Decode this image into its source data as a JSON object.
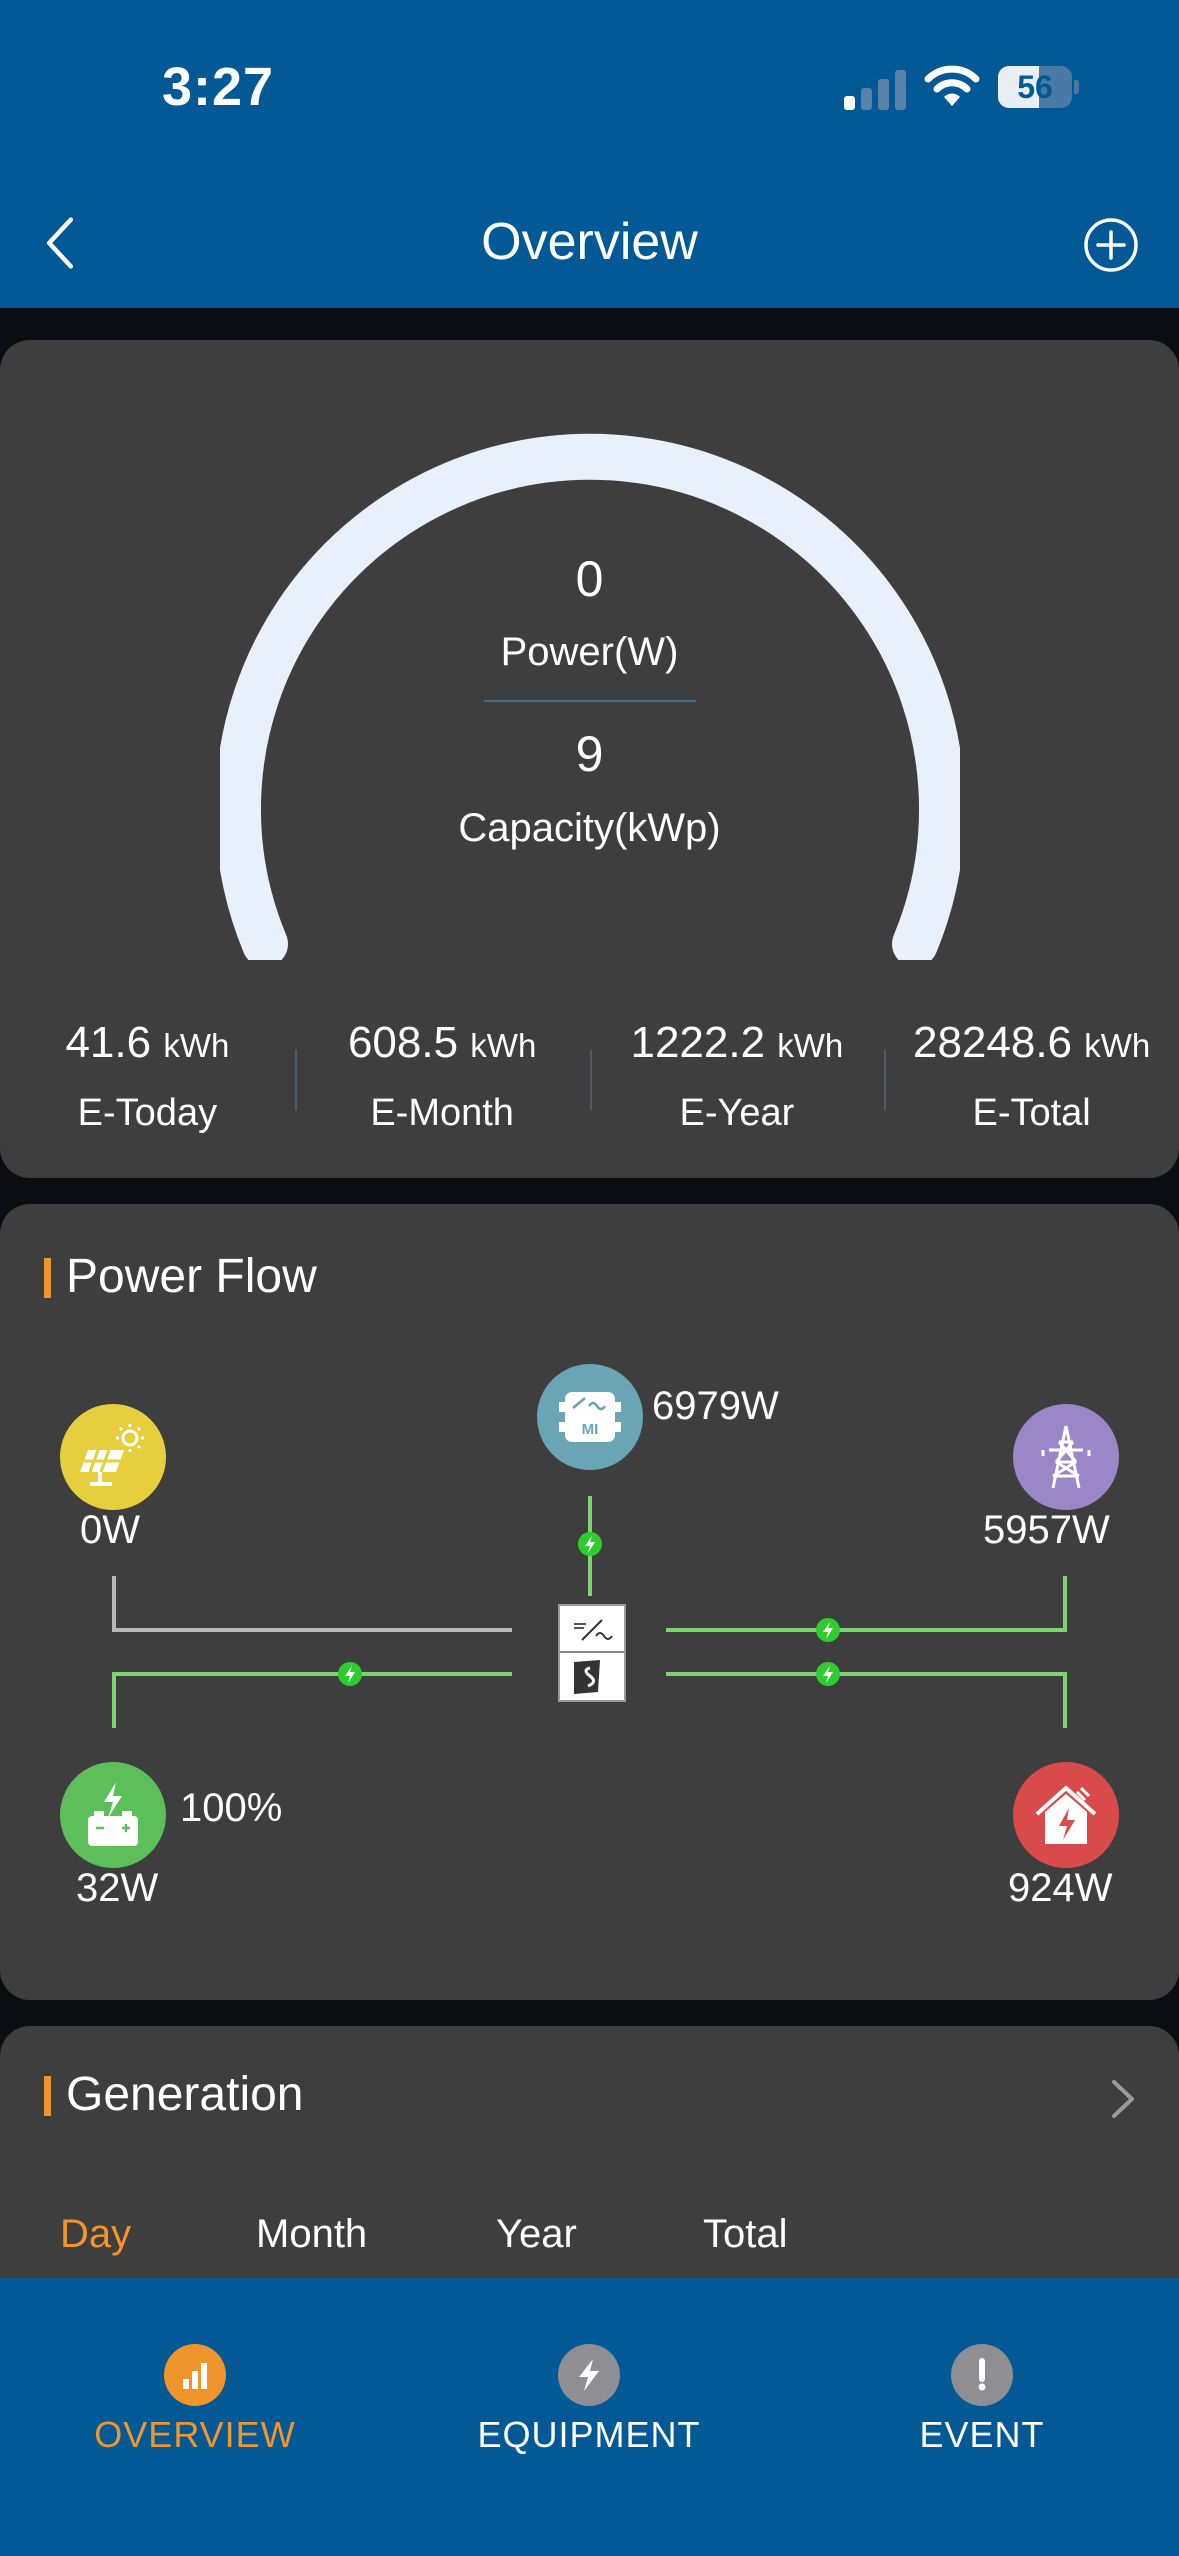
{
  "status_bar": {
    "time": "3:27",
    "battery_percent": "56",
    "battery_level": 0.56,
    "signal_bars_active": 1,
    "icons": [
      "cellular-signal-icon",
      "wifi-icon",
      "battery-icon"
    ]
  },
  "nav": {
    "title": "Overview",
    "back_icon": "chevron-left-icon",
    "add_icon": "plus-circle-icon"
  },
  "overview": {
    "power_value": "0",
    "power_label": "Power(W)",
    "capacity_value": "9",
    "capacity_label": "Capacity(kWp)",
    "gauge_fill_fraction": 0,
    "stats": [
      {
        "value": "41.6",
        "unit": "kWh",
        "label": "E-Today"
      },
      {
        "value": "608.5",
        "unit": "kWh",
        "label": "E-Month"
      },
      {
        "value": "1222.2",
        "unit": "kWh",
        "label": "E-Year"
      },
      {
        "value": "28248.6",
        "unit": "kWh",
        "label": "E-Total"
      }
    ]
  },
  "power_flow": {
    "title": "Power Flow",
    "solar": {
      "value": "0W",
      "icon": "solar-panel-icon",
      "color": "#e6ce3c"
    },
    "microinverter": {
      "value": "6979W",
      "icon": "microinverter-icon",
      "badge": "MI",
      "color": "#6aa5b5"
    },
    "grid": {
      "value": "5957W",
      "icon": "power-tower-icon",
      "color": "#9b86c8"
    },
    "battery": {
      "value": "32W",
      "soc": "100%",
      "icon": "battery-charge-icon",
      "color": "#5cbf5a"
    },
    "home": {
      "value": "924W",
      "icon": "home-power-icon",
      "color": "#d94b4b"
    },
    "inverter_icon": "hybrid-inverter-icon",
    "flow_color": "#7fd472",
    "idle_color": "#b9b9b9",
    "arrow_color": "#2ecc2e"
  },
  "generation": {
    "title": "Generation",
    "tabs": [
      "Day",
      "Month",
      "Year",
      "Total"
    ],
    "active_tab": "Day",
    "chevron_icon": "chevron-right-icon"
  },
  "tabbar": {
    "items": [
      {
        "label": "OVERVIEW",
        "icon": "bar-chart-icon",
        "active": true
      },
      {
        "label": "EQUIPMENT",
        "icon": "lightning-icon",
        "active": false
      },
      {
        "label": "EVENT",
        "icon": "exclamation-icon",
        "active": false
      }
    ],
    "active_color": "#f0952c"
  },
  "colors": {
    "brand_blue": "#035996",
    "card_bg": "#3e3e3e",
    "page_bg": "#0b0d12",
    "accent_orange": "#f0952c",
    "gauge_track": "#e8f0fb"
  }
}
